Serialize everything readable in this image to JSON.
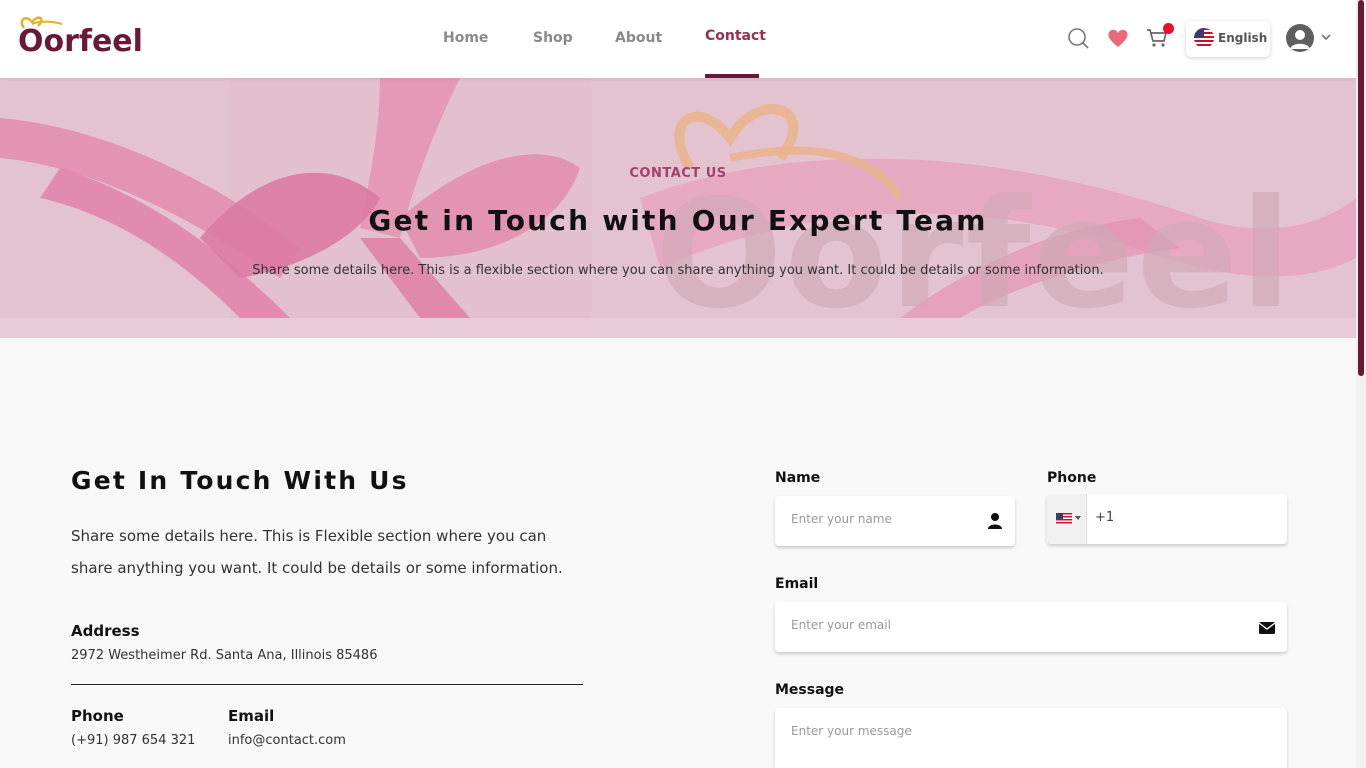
{
  "header": {
    "logo_text": "Oorfeel",
    "nav": [
      {
        "label": "Home"
      },
      {
        "label": "Shop"
      },
      {
        "label": "About"
      },
      {
        "label": "Contact",
        "active": true
      }
    ],
    "language": "English",
    "icons": [
      "search-icon",
      "heart-icon",
      "cart-icon",
      "us-flag-icon",
      "user-avatar-icon",
      "chevron-down-icon"
    ]
  },
  "hero": {
    "eyebrow": "CONTACT US",
    "title": "Get in Touch with Our Expert Team",
    "subtitle": "Share some details here. This is a flexible section where you can share anything you want. It could be details or some information.",
    "watermark": "Oorfeel"
  },
  "info": {
    "title": "Get In Touch With Us",
    "description": "Share some details here. This is Flexible section where you can share anything you want. It could be details or some information.",
    "address_label": "Address",
    "address_value": "2972 Westheimer Rd. Santa Ana, Illinois 85486",
    "phone_label": "Phone",
    "phone_value": "(+91) 987 654 321",
    "email_label": "Email",
    "email_value": "info@contact.com"
  },
  "form": {
    "name_label": "Name",
    "name_placeholder": "Enter your name",
    "phone_label": "Phone",
    "phone_code": "+1",
    "email_label": "Email",
    "email_placeholder": "Enter your email",
    "message_label": "Message",
    "message_placeholder": "Enter your message"
  },
  "colors": {
    "brand": "#6b1838",
    "accent": "#9b2d4d",
    "hero_bg": "#e9cbd7",
    "notification": "#e8102b",
    "heart": "#e9687a"
  }
}
